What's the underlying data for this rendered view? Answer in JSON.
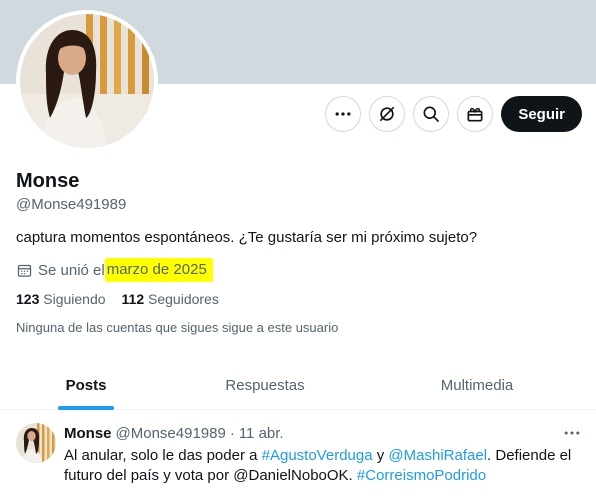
{
  "profile": {
    "name": "Monse",
    "handle": "@Monse491989",
    "bio": "captura momentos espontáneos. ¿Te gustaría ser mi próximo sujeto?",
    "joined_prefix": "Se unió el",
    "joined_date": "marzo de 2025",
    "following_count": "123",
    "following_label": "Siguiendo",
    "followers_count": "112",
    "followers_label": "Seguidores",
    "mutual_note": "Ninguna de las cuentas que sigues sigue a este usuario"
  },
  "actions": {
    "follow_label": "Seguir",
    "icons": [
      "more-icon",
      "grok-icon",
      "search-icon",
      "gift-icon"
    ]
  },
  "tabs": [
    {
      "label": "Posts",
      "active": true
    },
    {
      "label": "Respuestas",
      "active": false
    },
    {
      "label": "Multimedia",
      "active": false
    }
  ],
  "post": {
    "name": "Monse",
    "handle": "@Monse491989",
    "separator": "·",
    "date": "11 abr.",
    "text_1": "Al anular, solo le das poder a ",
    "link_1": "#AgustoVerduga",
    "text_2": " y ",
    "link_2": "@MashiRafael",
    "text_3": ". Defiende el futuro del país y vota por @DanielNoboOK. ",
    "link_3": "#CorreismoPodrido"
  },
  "colors": {
    "banner": "#cfd9de",
    "accent": "#1d9bf0",
    "highlight": "#ffff00",
    "text_primary": "#0f1419",
    "text_secondary": "#536471"
  }
}
